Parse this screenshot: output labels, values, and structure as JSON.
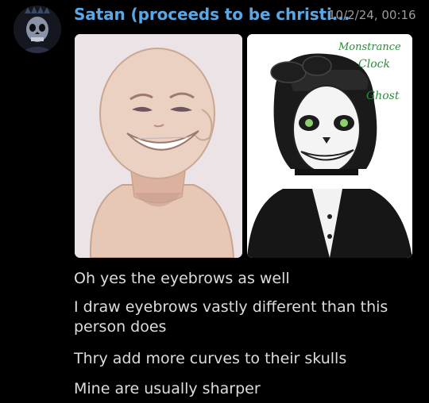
{
  "message": {
    "author": "Satan (proceeds to be christi...",
    "timestamp": "10/2/24, 00:16",
    "avatar_icon": "skull-icon",
    "attachments": [
      {
        "description_icon": "bald-smiling-figure-sketch"
      },
      {
        "description_icon": "skull-face-painted-character",
        "handwritten_text": [
          "Monstrance",
          "Clock",
          "Ghost"
        ]
      }
    ],
    "lines": [
      "Oh yes the eyebrows as well",
      "I draw eyebrows vastly different than this person does",
      "Thry add more curves to their skulls",
      "Mine are usually sharper"
    ]
  },
  "colors": {
    "background": "#000000",
    "author": "#5aa7e6",
    "timestamp": "#9a9ca3",
    "text": "#dcdde1"
  }
}
